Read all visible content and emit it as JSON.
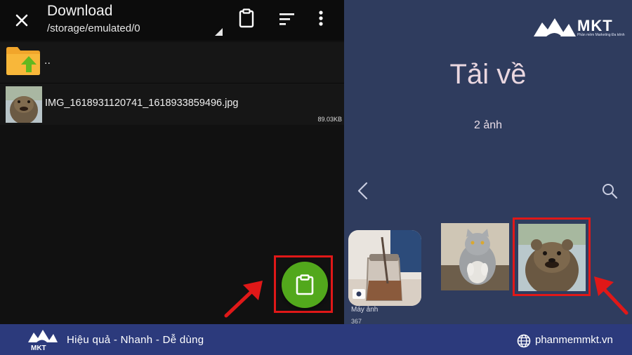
{
  "left_panel": {
    "title": "Download",
    "path": "/storage/emulated/0",
    "toolbar_icons": [
      "close-icon",
      "clipboard-icon",
      "sort-icon",
      "more-vert-icon"
    ],
    "files": [
      {
        "name": "..",
        "type": "parent-folder",
        "icon": "folder-up-icon"
      },
      {
        "name": "IMG_1618931120741_1618933859496.jpg",
        "type": "image",
        "size": "89.03KB"
      }
    ],
    "fab_icon": "paste-icon"
  },
  "right_panel": {
    "album_title": "Tải về",
    "photo_count": "2 ảnh",
    "albums": [
      {
        "label": "Máy ảnh",
        "count": "367"
      }
    ],
    "brand": {
      "name": "MKT",
      "subtitle": "Phần mềm Marketing Đa kênh"
    }
  },
  "banner": {
    "slogan": "Hiệu quả - Nhanh - Dễ dùng",
    "url": "phanmemmkt.vn"
  },
  "colors": {
    "fab_green": "#52a81c",
    "highlight_red": "#e01818",
    "gallery_bg": "#2f3c5e",
    "banner_bg": "#2c3a7c"
  }
}
